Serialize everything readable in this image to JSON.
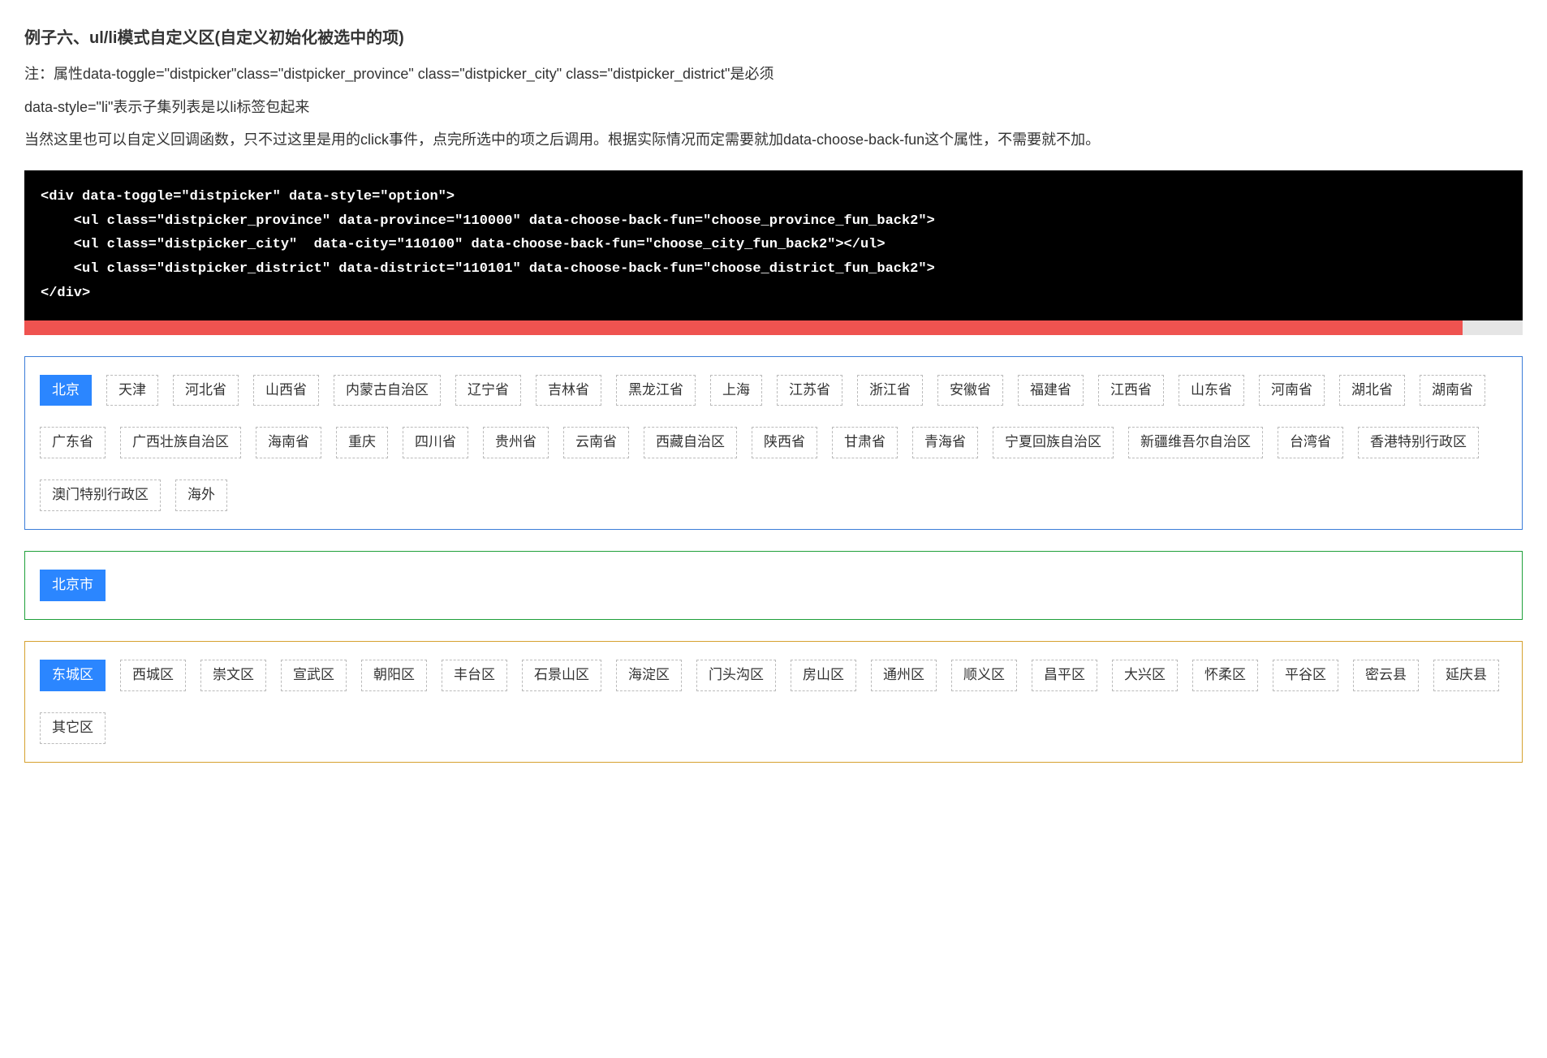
{
  "heading": "例子六、ul/li模式自定义区(自定义初始化被选中的项)",
  "paragraphs": [
    "注：属性data-toggle=\"distpicker\"class=\"distpicker_province\" class=\"distpicker_city\" class=\"distpicker_district\"是必须",
    "data-style=\"li\"表示子集列表是以li标签包起来",
    "当然这里也可以自定义回调函数，只不过这里是用的click事件，点完所选中的项之后调用。根据实际情况而定需要就加data-choose-back-fun这个属性，不需要就不加。"
  ],
  "code": "<div data-toggle=\"distpicker\" data-style=\"option\">\n    <ul class=\"distpicker_province\" data-province=\"110000\" data-choose-back-fun=\"choose_province_fun_back2\">\n    <ul class=\"distpicker_city\"  data-city=\"110100\" data-choose-back-fun=\"choose_city_fun_back2\"></ul>\n    <ul class=\"distpicker_district\" data-district=\"110101\" data-choose-back-fun=\"choose_district_fun_back2\">\n</div>",
  "province": {
    "selected": "北京",
    "items": [
      "北京",
      "天津",
      "河北省",
      "山西省",
      "内蒙古自治区",
      "辽宁省",
      "吉林省",
      "黑龙江省",
      "上海",
      "江苏省",
      "浙江省",
      "安徽省",
      "福建省",
      "江西省",
      "山东省",
      "河南省",
      "湖北省",
      "湖南省",
      "广东省",
      "广西壮族自治区",
      "海南省",
      "重庆",
      "四川省",
      "贵州省",
      "云南省",
      "西藏自治区",
      "陕西省",
      "甘肃省",
      "青海省",
      "宁夏回族自治区",
      "新疆维吾尔自治区",
      "台湾省",
      "香港特别行政区",
      "澳门特别行政区",
      "海外"
    ]
  },
  "city": {
    "selected": "北京市",
    "items": [
      "北京市"
    ]
  },
  "district": {
    "selected": "东城区",
    "items": [
      "东城区",
      "西城区",
      "崇文区",
      "宣武区",
      "朝阳区",
      "丰台区",
      "石景山区",
      "海淀区",
      "门头沟区",
      "房山区",
      "通州区",
      "顺义区",
      "昌平区",
      "大兴区",
      "怀柔区",
      "平谷区",
      "密云县",
      "延庆县",
      "其它区"
    ]
  }
}
